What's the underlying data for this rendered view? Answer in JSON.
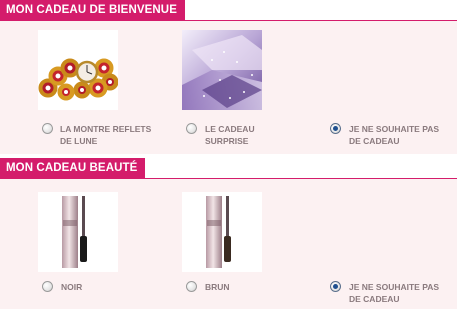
{
  "welcome_gift": {
    "title": "MON CADEAU DE BIENVENUE",
    "options": [
      {
        "line1": "LA MONTRE REFLETS",
        "line2": "DE LUNE",
        "icon": "watch-image",
        "checked": false
      },
      {
        "line1": "LE CADEAU",
        "line2": "SURPRISE",
        "icon": "gift-box-image",
        "checked": false
      },
      {
        "line1": "JE NE SOUHAITE PAS",
        "line2": "DE CADEAU",
        "icon": "",
        "checked": true
      }
    ]
  },
  "beauty_gift": {
    "title": "MON CADEAU BEAUTÉ",
    "options": [
      {
        "line1": "NOIR",
        "line2": "",
        "icon": "mascara-image",
        "checked": false
      },
      {
        "line1": "BRUN",
        "line2": "",
        "icon": "mascara-image",
        "checked": false
      },
      {
        "line1": "JE NE SOUHAITE PAS",
        "line2": "DE CADEAU",
        "icon": "",
        "checked": true
      }
    ]
  },
  "colors": {
    "accent": "#d41c6b",
    "panel_bg": "#fcf1f2",
    "label_text": "#8a7a7e",
    "radio_dot": "#1f4f8f"
  }
}
